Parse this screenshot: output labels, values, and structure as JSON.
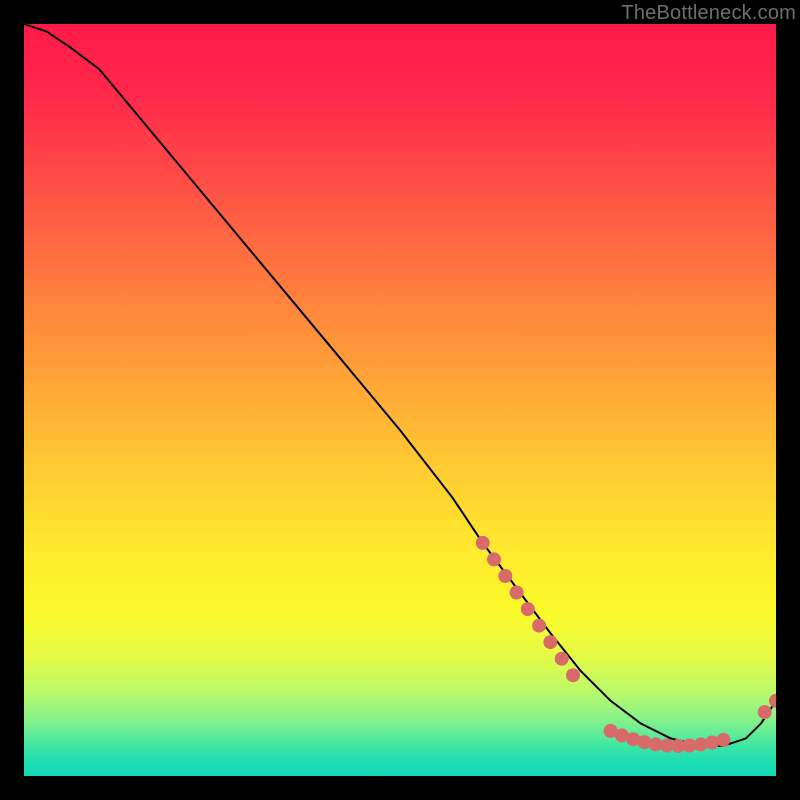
{
  "watermark": "TheBottleneck.com",
  "chart_data": {
    "type": "line",
    "title": "",
    "xlabel": "",
    "ylabel": "",
    "xlim": [
      0,
      100
    ],
    "ylim": [
      0,
      100
    ],
    "series": [
      {
        "name": "curve",
        "x": [
          0,
          3,
          6,
          10,
          20,
          30,
          40,
          50,
          57,
          61,
          64,
          67,
          70,
          74,
          78,
          82,
          86,
          90,
          93,
          96,
          98,
          100
        ],
        "y": [
          100,
          99,
          97,
          94,
          82,
          70,
          58,
          46,
          37,
          31,
          27,
          23,
          19,
          14,
          10,
          7,
          5,
          4,
          4,
          5,
          7,
          10
        ]
      }
    ],
    "scatter": [
      {
        "name": "cluster-transition",
        "x": [
          61,
          62.5,
          64,
          65.5,
          67,
          68.5,
          70,
          71.5,
          73
        ],
        "y": [
          31,
          28.8,
          26.6,
          24.4,
          22.2,
          20,
          17.8,
          15.6,
          13.4
        ]
      },
      {
        "name": "cluster-bottom",
        "x": [
          78,
          79.5,
          81,
          82.5,
          84,
          85.5,
          87,
          88.5,
          90,
          91.5,
          93
        ],
        "y": [
          6.0,
          5.4,
          4.9,
          4.5,
          4.2,
          4.05,
          4.0,
          4.05,
          4.2,
          4.45,
          4.8
        ]
      },
      {
        "name": "cluster-tail",
        "x": [
          98.5,
          100
        ],
        "y": [
          8.5,
          10
        ]
      }
    ]
  }
}
